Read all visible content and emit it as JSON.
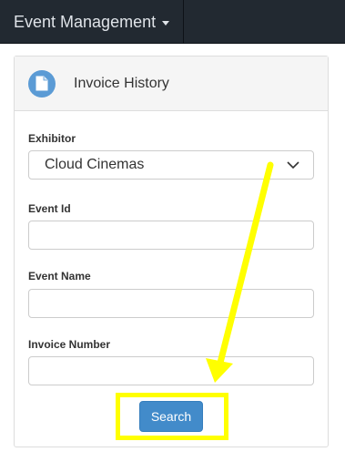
{
  "navbar": {
    "menu_label": "Event Management"
  },
  "panel": {
    "title": "Invoice History",
    "icon": "document-icon"
  },
  "form": {
    "exhibitor": {
      "label": "Exhibitor",
      "value": "Cloud Cinemas"
    },
    "event_id": {
      "label": "Event Id",
      "value": ""
    },
    "event_name": {
      "label": "Event Name",
      "value": ""
    },
    "invoice_number": {
      "label": "Invoice Number",
      "value": ""
    },
    "search_label": "Search"
  },
  "colors": {
    "navbar_bg": "#222931",
    "button_bg": "#428bca",
    "annotation": "#ffff00"
  }
}
